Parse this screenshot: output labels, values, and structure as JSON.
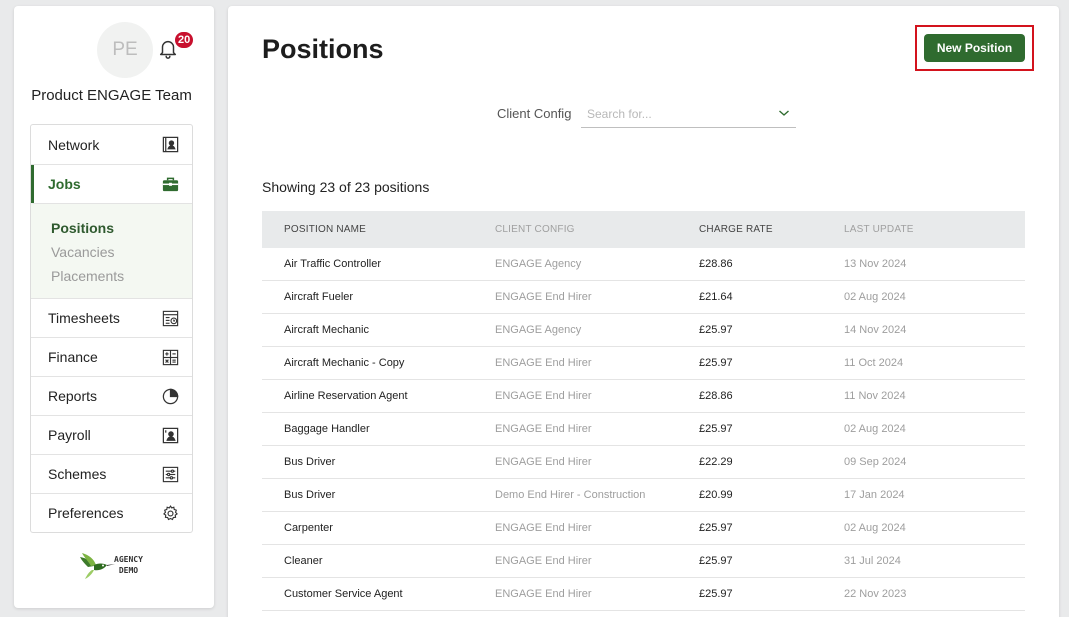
{
  "user": {
    "initials": "PE",
    "team_name": "Product ENGAGE Team",
    "notification_count": "20"
  },
  "nav": {
    "items": [
      {
        "label": "Network",
        "icon": "contact-card-icon"
      },
      {
        "label": "Jobs",
        "icon": "briefcase-icon"
      },
      {
        "label": "Timesheets",
        "icon": "timesheet-icon"
      },
      {
        "label": "Finance",
        "icon": "calculator-icon"
      },
      {
        "label": "Reports",
        "icon": "pie-chart-icon"
      },
      {
        "label": "Payroll",
        "icon": "payroll-icon"
      },
      {
        "label": "Schemes",
        "icon": "sliders-icon"
      },
      {
        "label": "Preferences",
        "icon": "gear-icon"
      }
    ],
    "jobs_sub": [
      "Positions",
      "Vacancies",
      "Placements"
    ]
  },
  "brand": {
    "line1": "AGENCY",
    "line2": "DEMO"
  },
  "main": {
    "title": "Positions",
    "new_button": "New Position",
    "filter_label": "Client Config",
    "filter_placeholder": "Search for...",
    "showing": "Showing 23 of 23 positions"
  },
  "table": {
    "headers": [
      "POSITION NAME",
      "CLIENT CONFIG",
      "CHARGE RATE",
      "LAST UPDATE"
    ],
    "rows": [
      [
        "Air Traffic Controller",
        "ENGAGE Agency",
        "£28.86",
        "13 Nov 2024"
      ],
      [
        "Aircraft Fueler",
        "ENGAGE End Hirer",
        "£21.64",
        "02 Aug 2024"
      ],
      [
        "Aircraft Mechanic",
        "ENGAGE Agency",
        "£25.97",
        "14 Nov 2024"
      ],
      [
        "Aircraft Mechanic - Copy",
        "ENGAGE End Hirer",
        "£25.97",
        "11 Oct 2024"
      ],
      [
        "Airline Reservation Agent",
        "ENGAGE End Hirer",
        "£28.86",
        "11 Nov 2024"
      ],
      [
        "Baggage Handler",
        "ENGAGE End Hirer",
        "£25.97",
        "02 Aug 2024"
      ],
      [
        "Bus Driver",
        "ENGAGE End Hirer",
        "£22.29",
        "09 Sep 2024"
      ],
      [
        "Bus Driver",
        "Demo End Hirer - Construction",
        "£20.99",
        "17 Jan 2024"
      ],
      [
        "Carpenter",
        "ENGAGE End Hirer",
        "£25.97",
        "02 Aug 2024"
      ],
      [
        "Cleaner",
        "ENGAGE End Hirer",
        "£25.97",
        "31 Jul 2024"
      ],
      [
        "Customer Service Agent",
        "ENGAGE End Hirer",
        "£25.97",
        "22 Nov 2023"
      ]
    ]
  },
  "colors": {
    "brand_green": "#2f6b2f",
    "badge_red": "#c8102e",
    "highlight_red": "#d3131d"
  }
}
